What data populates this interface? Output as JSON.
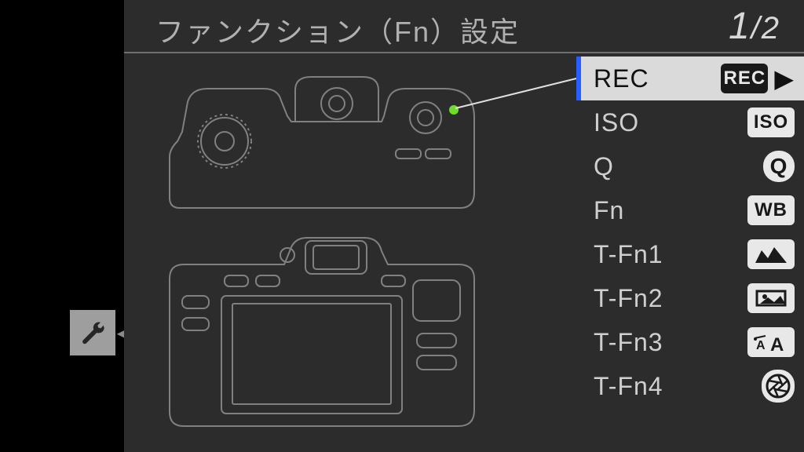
{
  "header": {
    "title": "ファンクション（Fn）設定",
    "page_current": "1",
    "page_total": "/2"
  },
  "list": {
    "items": [
      {
        "label": "REC",
        "icon": "REC",
        "selected": true,
        "style": "dark"
      },
      {
        "label": "ISO",
        "icon": "ISO",
        "style": "light"
      },
      {
        "label": "Q",
        "icon": "Q",
        "style": "light-round"
      },
      {
        "label": "Fn",
        "icon": "WB",
        "style": "light"
      },
      {
        "label": "T-Fn1",
        "icon": "histogram",
        "style": "light"
      },
      {
        "label": "T-Fn2",
        "icon": "preview",
        "style": "light"
      },
      {
        "label": "T-Fn3",
        "icon": "aa",
        "style": "light"
      },
      {
        "label": "T-Fn4",
        "icon": "aperture",
        "style": "light"
      }
    ]
  },
  "side": {
    "icon": "wrench"
  },
  "arrows": {
    "left": "◀",
    "right": "▶"
  }
}
